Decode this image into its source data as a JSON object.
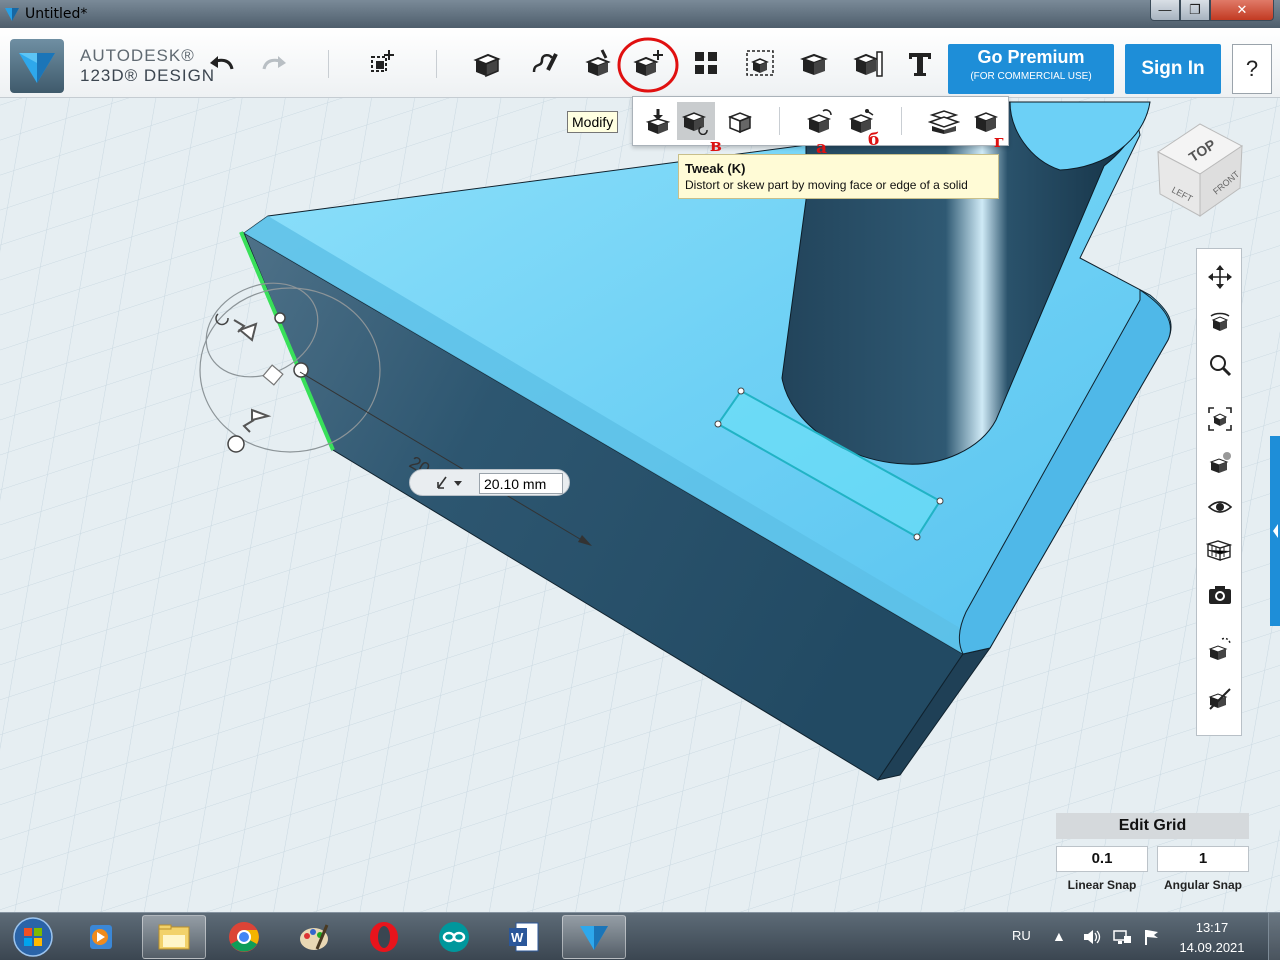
{
  "window": {
    "title": "Untitled*",
    "controls": {
      "minimize": "—",
      "maximize": "❐",
      "close": "✕"
    }
  },
  "brand": {
    "line1": "AUTODESK®",
    "line2": "123D® DESIGN"
  },
  "toolbar": {
    "undo_icon": "undo-icon",
    "redo_icon": "redo-icon",
    "tools": [
      "transform",
      "primitives",
      "sketch",
      "construct",
      "modify",
      "pattern",
      "grouping",
      "combine",
      "measure",
      "snap",
      "text"
    ],
    "go_premium": "Go Premium",
    "go_premium_sub": "(FOR COMMERCIAL USE)",
    "sign_in": "Sign In",
    "help": "?"
  },
  "modify_tooltip": "Modify",
  "modify_submenu": {
    "items": [
      "press-pull",
      "tweak",
      "split-face",
      "fillet",
      "chamfer",
      "split-solid",
      "shell"
    ],
    "selected": "tweak",
    "annotations": {
      "tweak": "в",
      "fillet": "а",
      "chamfer": "б",
      "shell": "г"
    }
  },
  "tweak_tooltip": {
    "title": "Tweak (K)",
    "description": "Distort or skew part by moving face or edge of a solid"
  },
  "viewport": {
    "dimension_label": "20",
    "dimension_value": "20.10 mm"
  },
  "viewcube": {
    "top": "TOP",
    "left": "LEFT",
    "front": "FRONT"
  },
  "nav_tools": [
    "pan",
    "orbit",
    "zoom",
    "fit",
    "views",
    "visibility",
    "material",
    "screenshot",
    "snap-tool",
    "hide"
  ],
  "edit_grid": {
    "title": "Edit Grid",
    "linear_snap_value": "0.1",
    "angular_snap_value": "1",
    "linear_snap_label": "Linear Snap",
    "angular_snap_label": "Angular Snap"
  },
  "taskbar": {
    "apps": [
      "explorer",
      "media-player",
      "chrome",
      "paint",
      "opera",
      "arduino",
      "word",
      "123d-design"
    ],
    "active_app": "123d-design",
    "language": "RU",
    "time": "13:17",
    "date": "14.09.2021"
  },
  "colors": {
    "accent_blue": "#1e8ed8",
    "solid_top": "#77d4f6",
    "annotation_red": "#d11111",
    "selected_edge": "#39e05a"
  }
}
